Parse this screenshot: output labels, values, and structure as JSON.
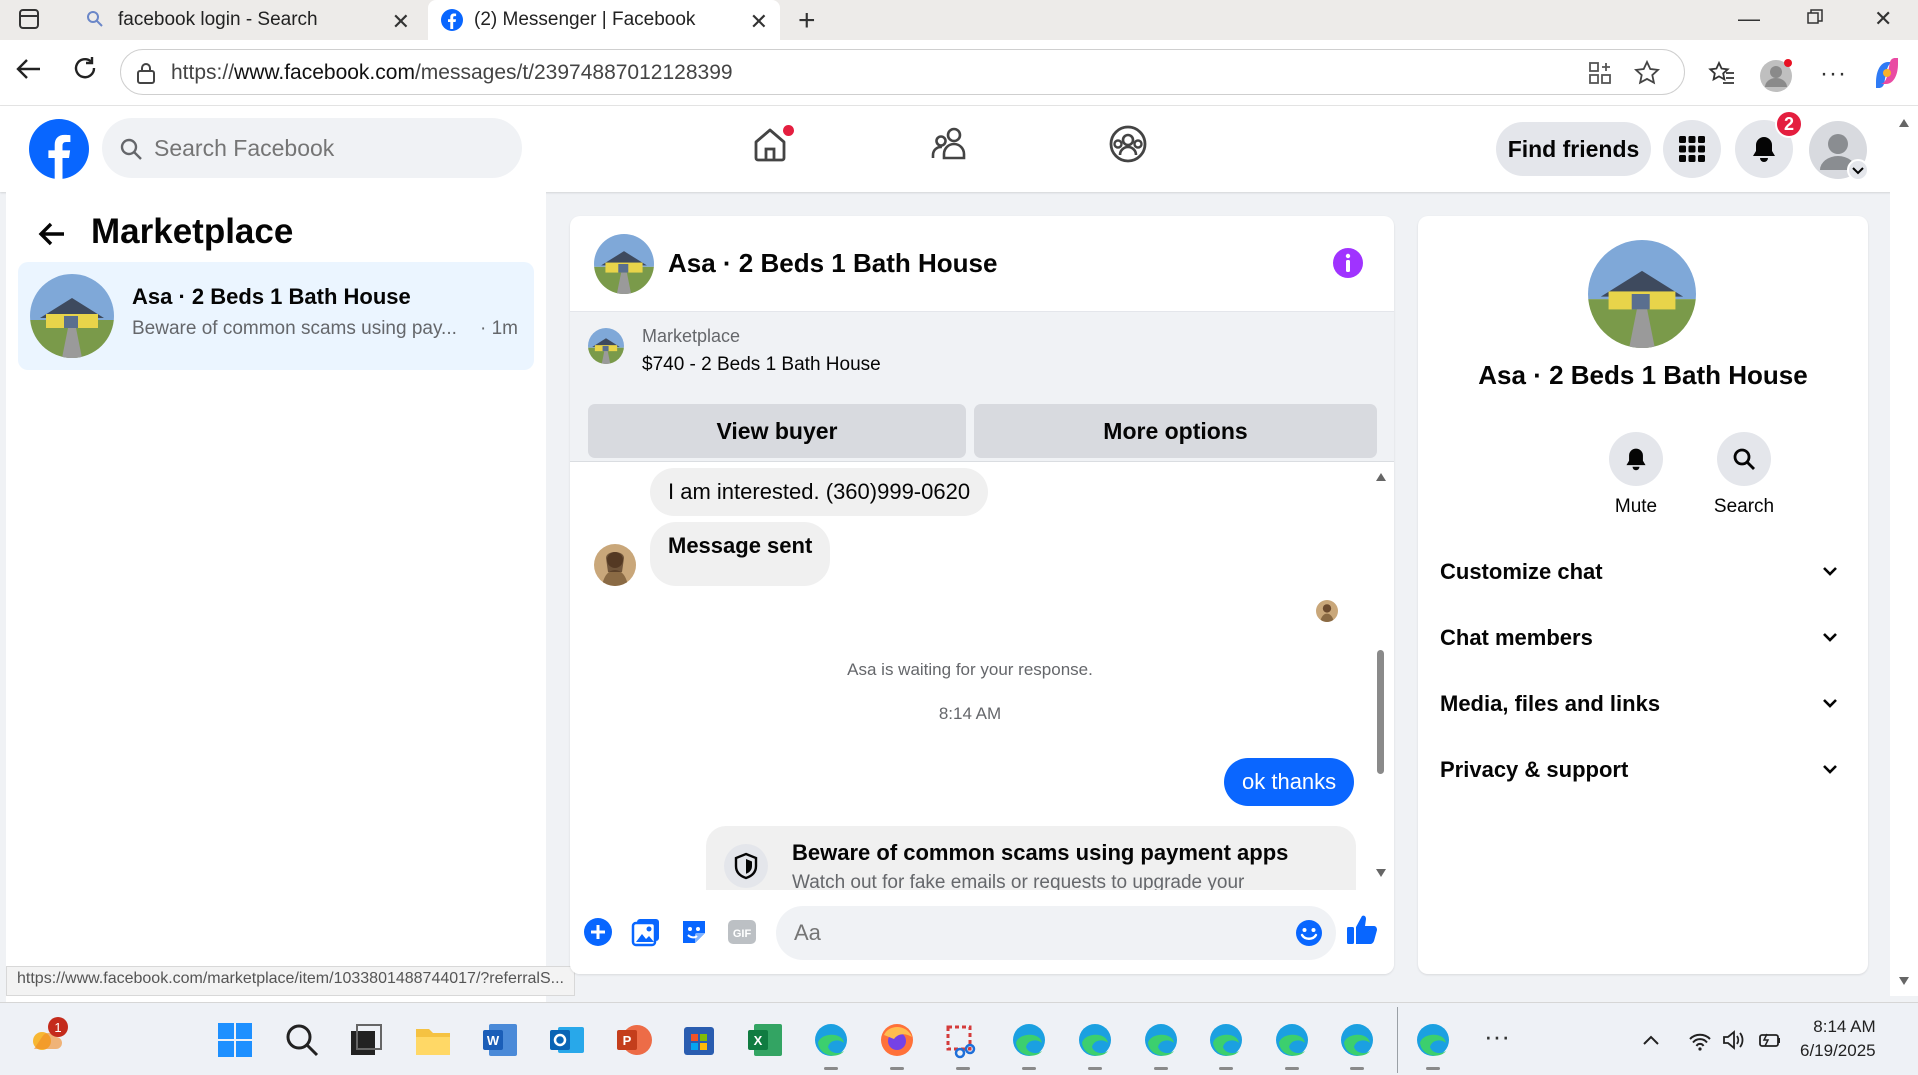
{
  "browser": {
    "tabs": [
      {
        "title": "facebook login - Search",
        "icon": "search-icon"
      },
      {
        "title": "(2) Messenger | Facebook",
        "icon": "facebook-icon"
      }
    ],
    "url_prefix": "https://",
    "url_domain": "www.facebook.com",
    "url_path": "/messages/t/23974887012128399"
  },
  "fb_header": {
    "search_placeholder": "Search Facebook",
    "find_friends": "Find friends",
    "notification_count": "2",
    "colors": {
      "brand": "#0866ff",
      "badge": "#e41e3f"
    }
  },
  "left_panel": {
    "title": "Marketplace",
    "conversations": [
      {
        "name": "Asa · 2 Beds 1 Bath House",
        "preview": "Beware of common scams using pay...",
        "time": "· 1m"
      }
    ],
    "status_url": "https://www.facebook.com/marketplace/item/1033801488744017/?referralS..."
  },
  "chat": {
    "title": "Asa · 2 Beds 1 Bath House",
    "listing": {
      "category": "Marketplace",
      "price_title": "$740 - 2 Beds 1 Bath House",
      "view_buyer": "View buyer",
      "more_options": "More options"
    },
    "messages": [
      {
        "from": "them",
        "text": "I am interested. (360)999-0620"
      },
      {
        "from": "them",
        "text": "Message sent"
      }
    ],
    "waiting_notice": "Asa is waiting for your response.",
    "timestamp": "8:14 AM",
    "my_message": "ok thanks",
    "scam_card": {
      "title": "Beware of common scams using payment apps",
      "body": "Watch out for fake emails or requests to upgrade your"
    },
    "composer_placeholder": "Aa",
    "colors": {
      "my_bubble": "#0a66ff",
      "info_icon": "#a033ff"
    }
  },
  "right_panel": {
    "title": "Asa · 2 Beds 1 Bath House",
    "actions": [
      {
        "label": "Mute",
        "icon": "bell-icon"
      },
      {
        "label": "Search",
        "icon": "search-icon"
      }
    ],
    "sections": [
      "Customize chat",
      "Chat members",
      "Media, files and links",
      "Privacy & support"
    ]
  },
  "taskbar": {
    "weather_badge": "1",
    "time": "8:14 AM",
    "date": "6/19/2025"
  }
}
